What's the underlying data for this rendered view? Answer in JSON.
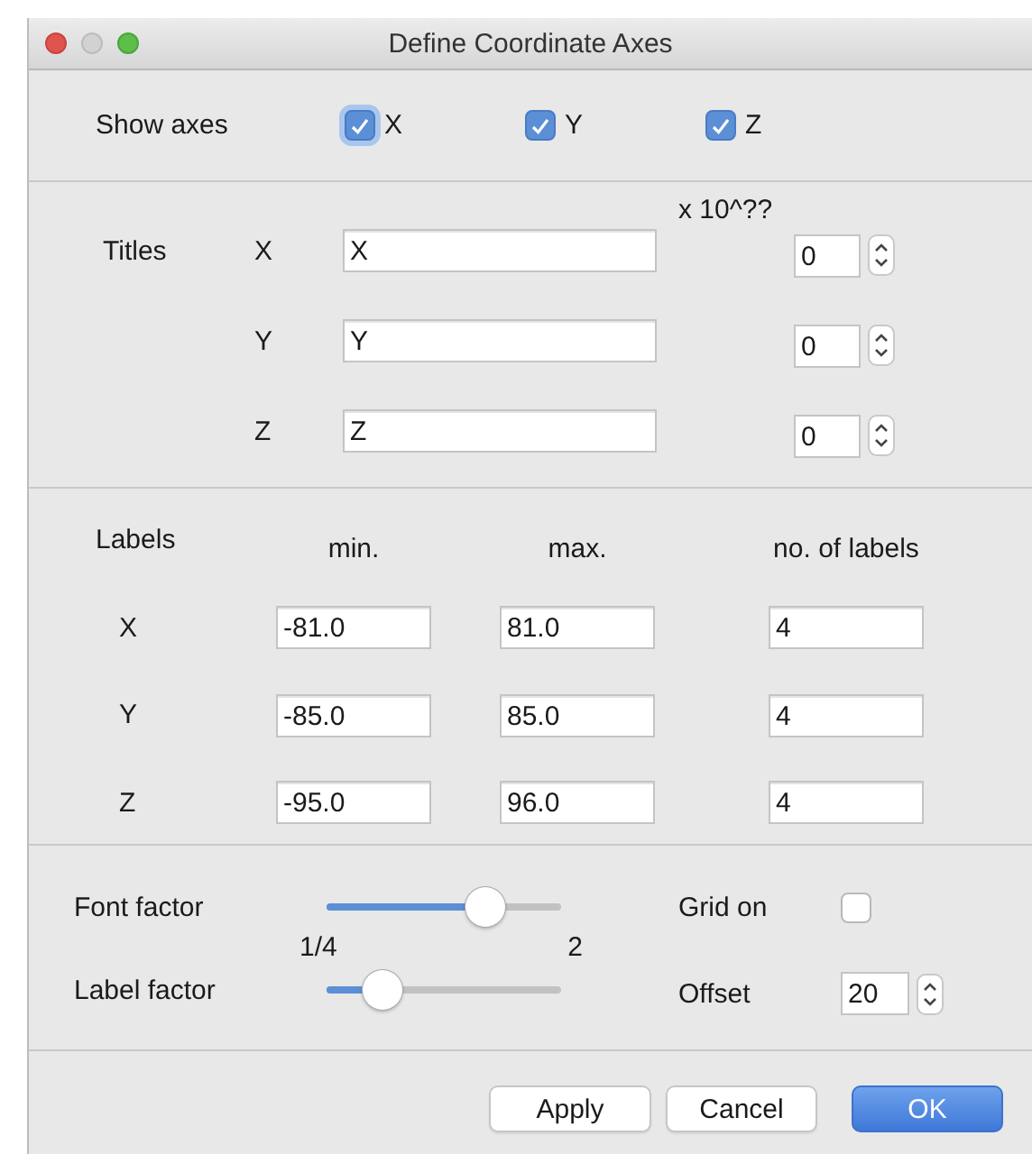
{
  "window": {
    "title": "Define Coordinate Axes"
  },
  "show_axes": {
    "label": "Show axes",
    "axes": [
      {
        "label": "X",
        "checked": true,
        "focused": true
      },
      {
        "label": "Y",
        "checked": true,
        "focused": false
      },
      {
        "label": "Z",
        "checked": true,
        "focused": false
      }
    ]
  },
  "titles": {
    "label": "Titles",
    "exponent_header": "x 10^??",
    "rows": [
      {
        "axis": "X",
        "value": "X",
        "exponent": "0"
      },
      {
        "axis": "Y",
        "value": "Y",
        "exponent": "0"
      },
      {
        "axis": "Z",
        "value": "Z",
        "exponent": "0"
      }
    ]
  },
  "labels": {
    "label": "Labels",
    "columns": [
      "min.",
      "max.",
      "no. of labels"
    ],
    "rows": [
      {
        "axis": "X",
        "min": "-81.0",
        "max": "81.0",
        "count": "4"
      },
      {
        "axis": "Y",
        "min": "-85.0",
        "max": "85.0",
        "count": "4"
      },
      {
        "axis": "Z",
        "min": "-95.0",
        "max": "96.0",
        "count": "4"
      }
    ]
  },
  "factors": {
    "font_factor": {
      "label": "Font factor",
      "level": 0.68
    },
    "label_factor": {
      "label": "Label factor",
      "level": 0.24,
      "min_label": "1/4",
      "max_label": "2"
    },
    "grid": {
      "label": "Grid on",
      "checked": false
    },
    "offset": {
      "label": "Offset",
      "value": "20"
    }
  },
  "buttons": [
    {
      "label": "Apply",
      "default": false
    },
    {
      "label": "Cancel",
      "default": false
    },
    {
      "label": "OK",
      "default": true
    }
  ]
}
